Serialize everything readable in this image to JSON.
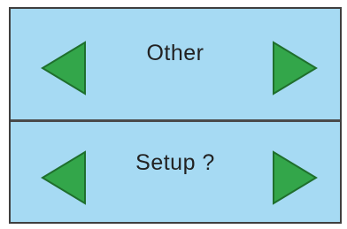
{
  "rows": [
    {
      "label": "Other"
    },
    {
      "label": "Setup ?"
    }
  ],
  "icons": {
    "prev": "arrow-left-icon",
    "next": "arrow-right-icon"
  },
  "colors": {
    "panel_bg": "#a6daf3",
    "arrow_fill": "#33a64a",
    "arrow_stroke": "#1f6f2d",
    "divider": "#4a4a4a"
  }
}
